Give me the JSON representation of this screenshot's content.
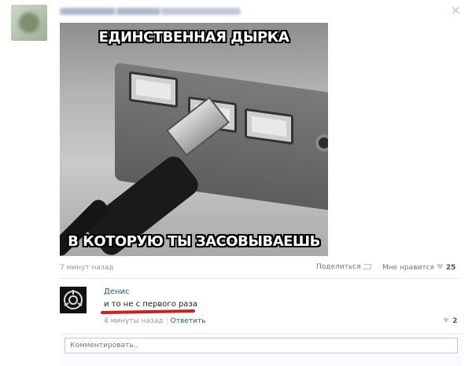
{
  "meme": {
    "caption_top": "ЕДИНСТВЕННАЯ ДЫРКА",
    "caption_bottom": "В КОТОРУЮ ТЫ ЗАСОВЫВАЕШЬ"
  },
  "post": {
    "time": "7 минут назад",
    "share_label": "Поделиться",
    "like_label": "Мне нравится",
    "like_count": "25"
  },
  "comment": {
    "author": "Денис",
    "text": "и то не с первого раза",
    "time": "4 минуты назад",
    "separator": "|",
    "reply_label": "Ответить",
    "like_count": "2"
  },
  "comment_input": {
    "placeholder": "Комментировать.."
  },
  "icons": {
    "close": "close-icon",
    "share": "share-icon",
    "like": "heart-icon"
  },
  "colors": {
    "link": "#2b587a",
    "muted": "#999999",
    "highlight": "#cc2020"
  }
}
